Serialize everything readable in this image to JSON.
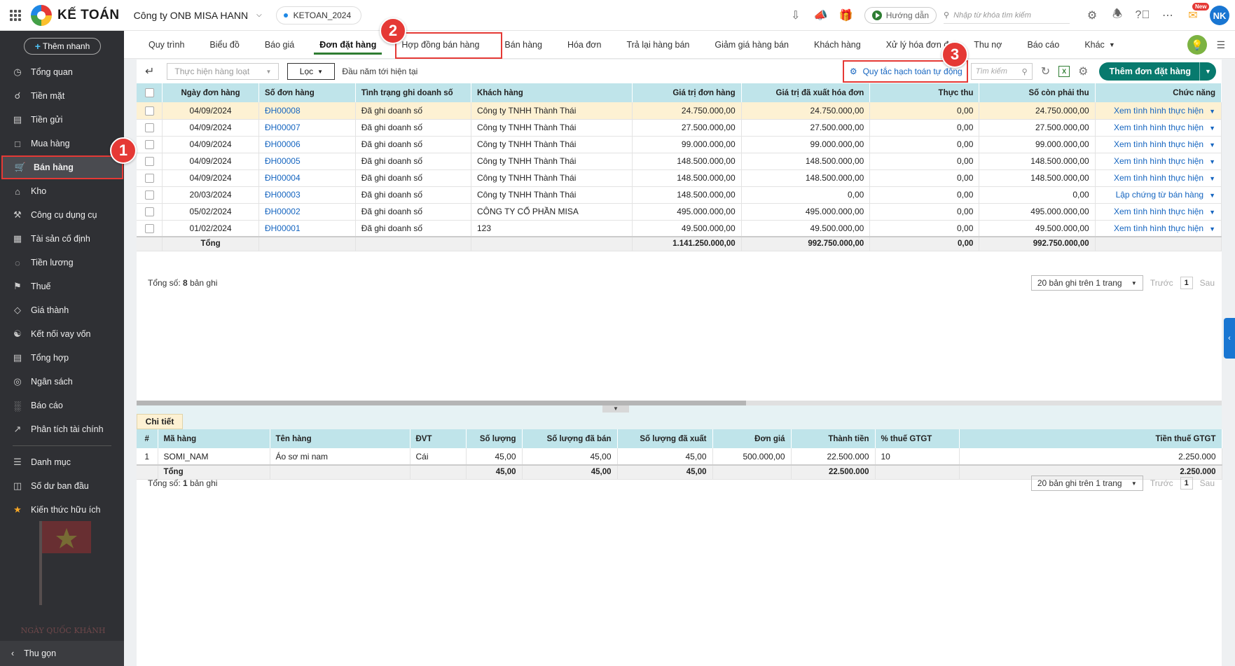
{
  "app": {
    "logo_text": "KẾ TOÁN",
    "company": "Công ty ONB MISA HANN",
    "database": "KETOAN_2024",
    "guide_label": "Hướng dẫn",
    "search_placeholder": "Nhập từ khóa tìm kiếm",
    "new_badge": "New",
    "user_initials": "NK"
  },
  "sidebar": {
    "quick_add": "Thêm nhanh",
    "items": [
      {
        "label": "Tổng quan",
        "icon": "dashboard-icon"
      },
      {
        "label": "Tiền mặt",
        "icon": "cash-icon"
      },
      {
        "label": "Tiền gửi",
        "icon": "bank-icon"
      },
      {
        "label": "Mua hàng",
        "icon": "purchase-icon"
      },
      {
        "label": "Bán hàng",
        "icon": "cart-icon"
      },
      {
        "label": "Kho",
        "icon": "warehouse-icon"
      },
      {
        "label": "Công cụ dụng cụ",
        "icon": "tools-icon"
      },
      {
        "label": "Tài sản cố định",
        "icon": "asset-icon"
      },
      {
        "label": "Tiền lương",
        "icon": "salary-icon"
      },
      {
        "label": "Thuế",
        "icon": "tax-icon"
      },
      {
        "label": "Giá thành",
        "icon": "price-tag-icon"
      },
      {
        "label": "Kết nối vay vốn",
        "icon": "loan-icon"
      },
      {
        "label": "Tổng hợp",
        "icon": "summary-icon"
      },
      {
        "label": "Ngân sách",
        "icon": "budget-icon"
      },
      {
        "label": "Báo cáo",
        "icon": "report-icon"
      },
      {
        "label": "Phân tích tài chính",
        "icon": "analytics-icon"
      },
      {
        "label": "Danh mục",
        "icon": "list-icon"
      },
      {
        "label": "Số dư ban đầu",
        "icon": "balance-icon"
      },
      {
        "label": "Kiến thức hữu ích",
        "icon": "knowledge-icon"
      }
    ],
    "decor_text": "NGÀY QUỐC KHÁNH",
    "collapse": "Thu gọn"
  },
  "markers": [
    "1",
    "2",
    "3"
  ],
  "tabs": [
    "Quy trình",
    "Biểu đồ",
    "Báo giá",
    "Đơn đặt hàng",
    "Hợp đồng bán hàng",
    "Bán hàng",
    "Hóa đơn",
    "Trả lại hàng bán",
    "Giảm giá hàng bán",
    "Khách hàng",
    "Xử lý hóa đơn đ",
    "Thu nợ",
    "Báo cáo",
    "Khác"
  ],
  "toolbar": {
    "bulk_action": "Thực hiện hàng loạt",
    "filter": "Lọc",
    "period": "Đầu năm tới hiện tại",
    "rule_link": "Quy tắc hạch toán tự động",
    "search_placeholder": "Tìm kiếm",
    "add_button": "Thêm đơn đặt hàng"
  },
  "orders": {
    "columns": [
      "Ngày đơn hàng",
      "Số đơn hàng",
      "Tình trạng ghi doanh số",
      "Khách hàng",
      "Giá trị đơn hàng",
      "Giá trị đã xuất hóa đơn",
      "Thực thu",
      "Số còn phải thu",
      "Chức năng"
    ],
    "rows": [
      {
        "date": "04/09/2024",
        "no": "ĐH00008",
        "status": "Đã ghi doanh số",
        "customer": "Công ty TNHH Thành Thái",
        "value": "24.750.000,00",
        "invoiced": "24.750.000,00",
        "collected": "0,00",
        "remaining": "24.750.000,00",
        "action": "Xem tình hình thực hiện"
      },
      {
        "date": "04/09/2024",
        "no": "ĐH00007",
        "status": "Đã ghi doanh số",
        "customer": "Công ty TNHH Thành Thái",
        "value": "27.500.000,00",
        "invoiced": "27.500.000,00",
        "collected": "0,00",
        "remaining": "27.500.000,00",
        "action": "Xem tình hình thực hiện"
      },
      {
        "date": "04/09/2024",
        "no": "ĐH00006",
        "status": "Đã ghi doanh số",
        "customer": "Công ty TNHH Thành Thái",
        "value": "99.000.000,00",
        "invoiced": "99.000.000,00",
        "collected": "0,00",
        "remaining": "99.000.000,00",
        "action": "Xem tình hình thực hiện"
      },
      {
        "date": "04/09/2024",
        "no": "ĐH00005",
        "status": "Đã ghi doanh số",
        "customer": "Công ty TNHH Thành Thái",
        "value": "148.500.000,00",
        "invoiced": "148.500.000,00",
        "collected": "0,00",
        "remaining": "148.500.000,00",
        "action": "Xem tình hình thực hiện"
      },
      {
        "date": "04/09/2024",
        "no": "ĐH00004",
        "status": "Đã ghi doanh số",
        "customer": "Công ty TNHH Thành Thái",
        "value": "148.500.000,00",
        "invoiced": "148.500.000,00",
        "collected": "0,00",
        "remaining": "148.500.000,00",
        "action": "Xem tình hình thực hiện"
      },
      {
        "date": "20/03/2024",
        "no": "ĐH00003",
        "status": "Đã ghi doanh số",
        "customer": "Công ty TNHH Thành Thái",
        "value": "148.500.000,00",
        "invoiced": "0,00",
        "collected": "0,00",
        "remaining": "0,00",
        "action": "Lập chứng từ bán hàng"
      },
      {
        "date": "05/02/2024",
        "no": "ĐH00002",
        "status": "Đã ghi doanh số",
        "customer": "CÔNG TY CỔ PHẦN MISA",
        "value": "495.000.000,00",
        "invoiced": "495.000.000,00",
        "collected": "0,00",
        "remaining": "495.000.000,00",
        "action": "Xem tình hình thực hiện"
      },
      {
        "date": "01/02/2024",
        "no": "ĐH00001",
        "status": "Đã ghi doanh số",
        "customer": "123",
        "value": "49.500.000,00",
        "invoiced": "49.500.000,00",
        "collected": "0,00",
        "remaining": "49.500.000,00",
        "action": "Xem tình hình thực hiện"
      }
    ],
    "total_label": "Tổng",
    "totals": {
      "value": "1.141.250.000,00",
      "invoiced": "992.750.000,00",
      "collected": "0,00",
      "remaining": "992.750.000,00"
    },
    "count_prefix": "Tổng số:",
    "count": "8",
    "count_suffix": "bản ghi",
    "page_size": "20 bản ghi trên 1 trang",
    "prev": "Trước",
    "page": "1",
    "next": "Sau"
  },
  "detail": {
    "tab": "Chi tiết",
    "columns": [
      "#",
      "Mã hàng",
      "Tên hàng",
      "ĐVT",
      "Số lượng",
      "Số lượng đã bán",
      "Số lượng đã xuất",
      "Đơn giá",
      "Thành tiền",
      "% thuế GTGT",
      "Tiền thuế GTGT"
    ],
    "rows": [
      {
        "idx": "1",
        "code": "SOMI_NAM",
        "name": "Áo sơ mi nam",
        "unit": "Cái",
        "qty": "45,00",
        "sold": "45,00",
        "exported": "45,00",
        "price": "500.000,00",
        "amount": "22.500.000",
        "vat_rate": "10",
        "vat": "2.250.000"
      }
    ],
    "total_label": "Tổng",
    "totals": {
      "qty": "45,00",
      "sold": "45,00",
      "exported": "45,00",
      "amount": "22.500.000",
      "vat": "2.250.000"
    },
    "count_prefix": "Tổng số:",
    "count": "1",
    "count_suffix": "bản ghi",
    "page_size": "20 bản ghi trên 1 trang",
    "prev": "Trước",
    "page": "1",
    "next": "Sau"
  }
}
